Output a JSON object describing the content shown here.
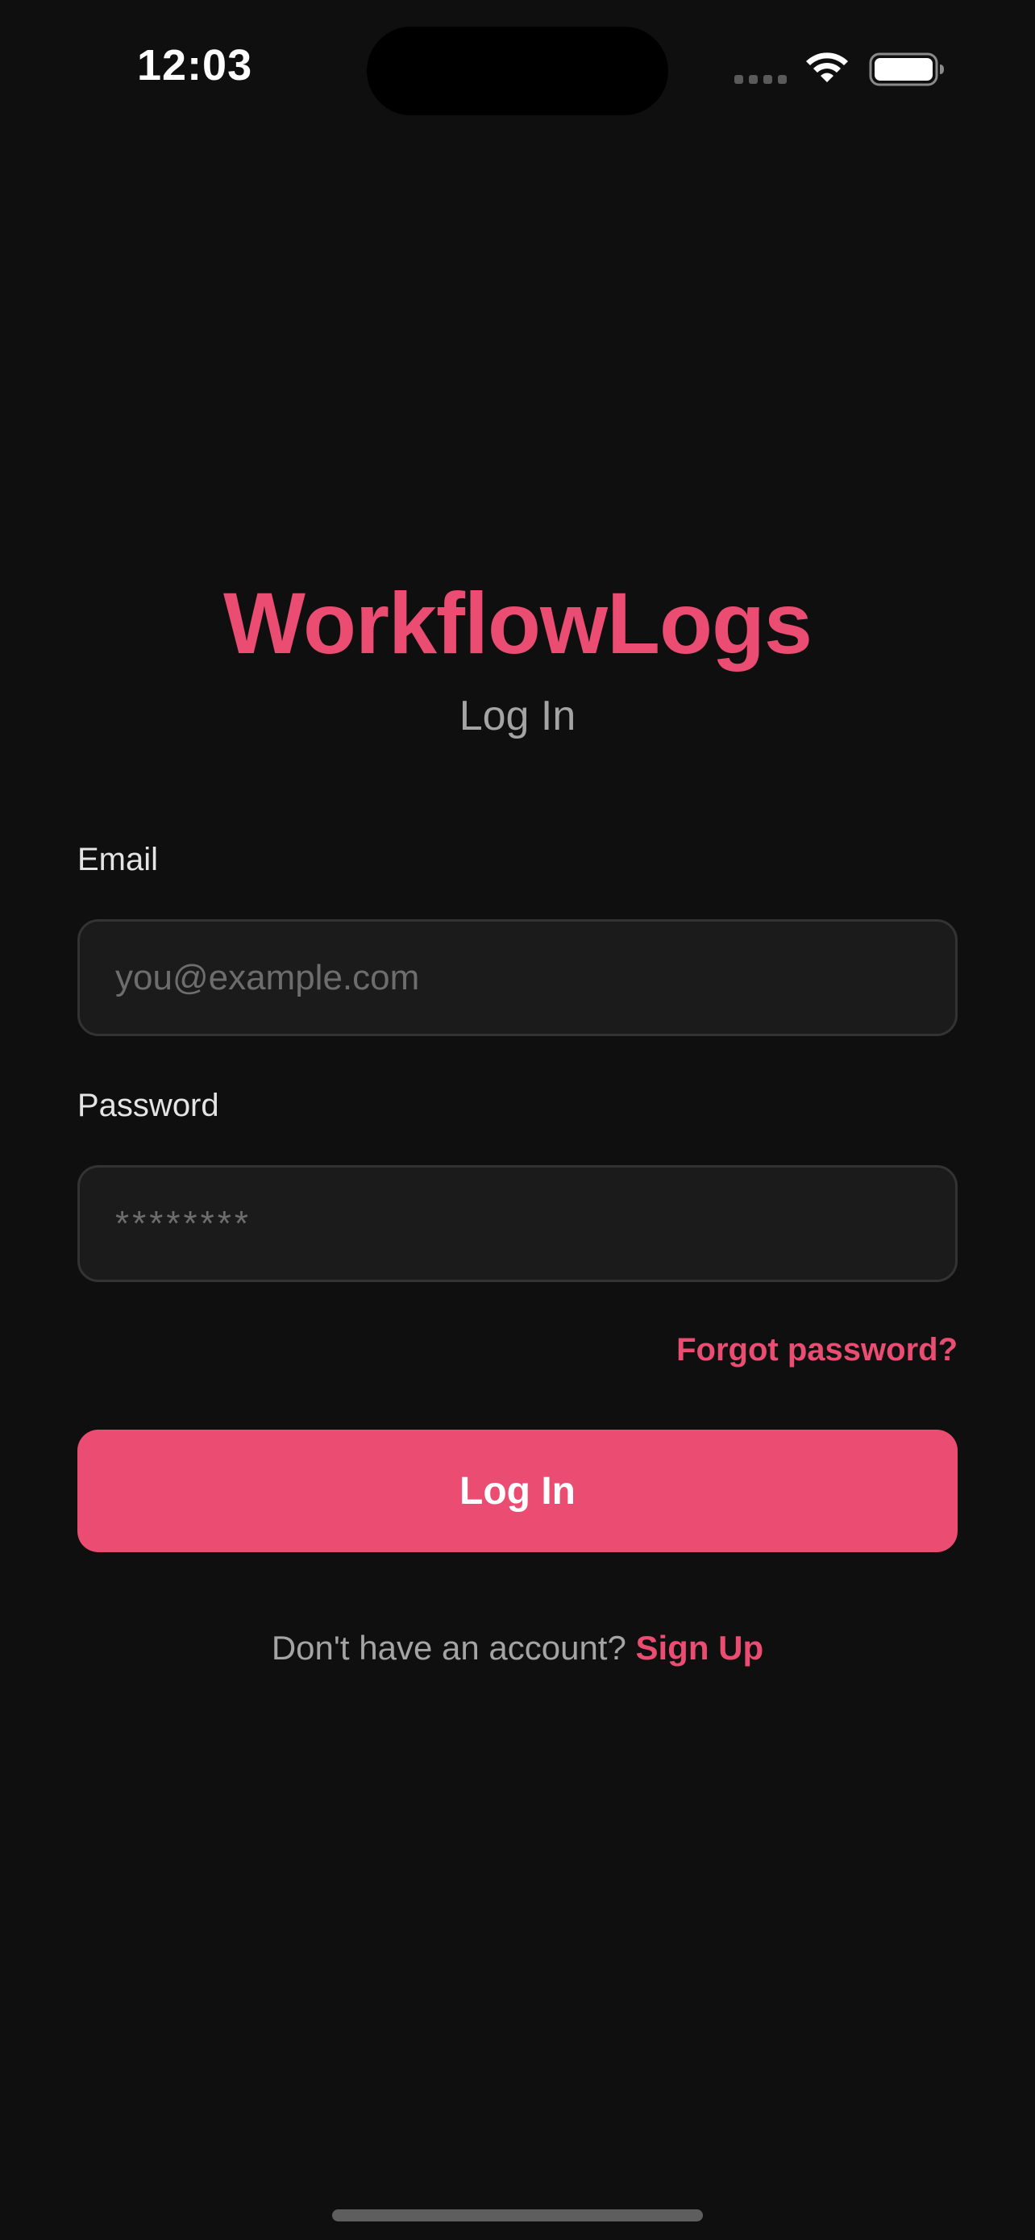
{
  "status_bar": {
    "time": "12:03",
    "icons": [
      "cellular-signal-icon",
      "wifi-icon",
      "battery-icon"
    ]
  },
  "app": {
    "title": "WorkflowLogs",
    "subtitle": "Log In"
  },
  "form": {
    "email": {
      "label": "Email",
      "value": "",
      "placeholder": "you@example.com"
    },
    "password": {
      "label": "Password",
      "value": "",
      "placeholder": "********"
    },
    "forgot_label": "Forgot password?",
    "submit_label": "Log In"
  },
  "signup": {
    "prompt": "Don't have an account? ",
    "link_label": "Sign Up"
  },
  "colors": {
    "background": "#0f0f0f",
    "accent": "#ea4c72",
    "field_bg": "#1b1b1b",
    "field_border": "#333333",
    "muted_text": "#a4a4a4"
  }
}
